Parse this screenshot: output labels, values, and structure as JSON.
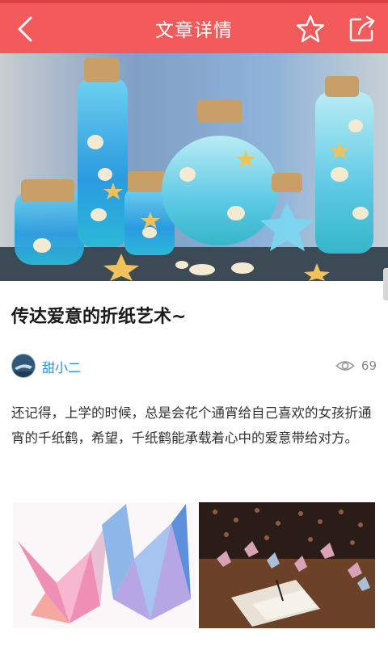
{
  "header": {
    "title": "文章详情",
    "back_icon": "back-arrow-icon",
    "favorite_icon": "star-outline-icon",
    "share_icon": "share-icon",
    "background_color": "#f35a5c"
  },
  "article": {
    "title": "传达爱意的折纸艺术~",
    "author": {
      "name": "甜小二",
      "name_color": "#2a8fd8"
    },
    "view_count": "69",
    "view_icon": "eye-icon",
    "paragraph": "还记得，上学的时候，总是会花个通宵给自己喜欢的女孩折通宵的千纸鹤，希望，千纸鹤能承载着心中的爱意带给对方。"
  }
}
